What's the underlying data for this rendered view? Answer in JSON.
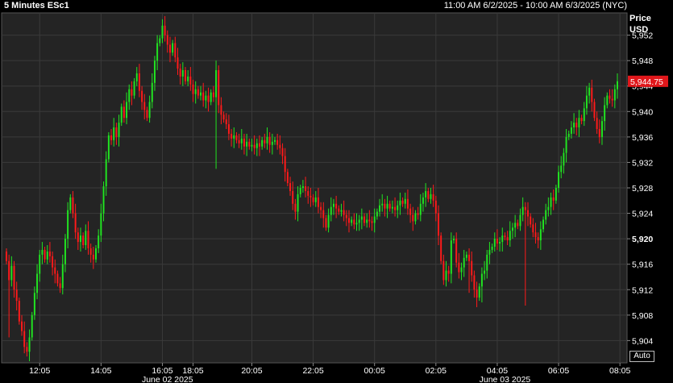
{
  "header": {
    "chart_label": "5 Minutes ESc1",
    "time_range": "11:00 AM 6/2/2025 - 10:00 AM 6/3/2025 (NYC)"
  },
  "axis": {
    "price_label": "Price",
    "currency_label": "USD",
    "auto_label": "Auto"
  },
  "colors": {
    "up": "#21e421",
    "down": "#ff1a1a",
    "plot_bg": "#242424",
    "grid": "#3a3a3a",
    "last_price_bg": "#e0171b"
  },
  "chart_data": {
    "type": "candlestick",
    "title": "5 Minutes ESc1",
    "ylabel": "Price USD",
    "ylim": [
      5900.5,
      5955.5
    ],
    "y_ticks": [
      5904,
      5908,
      5912,
      5916,
      5920,
      5924,
      5928,
      5932,
      5936,
      5940,
      5944,
      5948,
      5952
    ],
    "bold_tick": 5920,
    "last_price": "5,944.75",
    "last_value": 5944.75,
    "x_ticks": [
      "12:05",
      "14:05",
      "16:05",
      "18:05",
      "20:05",
      "22:05",
      "00:05",
      "02:05",
      "04:05",
      "06:05",
      "08:05"
    ],
    "date_labels": [
      "June 02 2025",
      "June 03 2025"
    ],
    "x_tick_index": [
      13,
      37,
      61,
      73,
      96,
      120,
      144,
      168,
      192,
      216,
      240
    ],
    "date_label_index": [
      63,
      195
    ],
    "grid": true,
    "closes": [
      5916.5,
      5913.5,
      5915.75,
      5912,
      5910.25,
      5907,
      5905.5,
      5903,
      5902.25,
      5904.5,
      5908,
      5911.5,
      5914.5,
      5917.5,
      5918.25,
      5916.75,
      5918,
      5917.25,
      5915.5,
      5914.5,
      5913,
      5912.25,
      5916,
      5920,
      5924.5,
      5926.5,
      5924,
      5921,
      5919.5,
      5920.5,
      5919,
      5921.25,
      5918.5,
      5917.5,
      5916.75,
      5918.5,
      5920.5,
      5924,
      5928.25,
      5932.5,
      5936.25,
      5935.5,
      5937.5,
      5936,
      5938.25,
      5940.75,
      5939,
      5941.5,
      5943.5,
      5942.5,
      5944.75,
      5946,
      5943.25,
      5941.5,
      5940.25,
      5939,
      5941.5,
      5944.5,
      5948,
      5950.75,
      5951.5,
      5953.5,
      5952,
      5950.5,
      5949.25,
      5950.75,
      5948.5,
      5946.75,
      5945.5,
      5946.5,
      5944.75,
      5945.5,
      5944.25,
      5942.75,
      5943.5,
      5942.5,
      5943,
      5941.75,
      5942.5,
      5941.5,
      5943,
      5942.25,
      5946.5,
      5941,
      5939.5,
      5938.75,
      5938,
      5936.5,
      5935.75,
      5936.25,
      5935.5,
      5935,
      5935.75,
      5934.5,
      5935.25,
      5934.5,
      5934.75,
      5934.25,
      5935,
      5934.5,
      5935.5,
      5935,
      5936,
      5934.75,
      5935.25,
      5935.5,
      5934.75,
      5934.25,
      5933,
      5930.5,
      5928.75,
      5927.5,
      5925.5,
      5924.25,
      5927,
      5928,
      5928.25,
      5927.5,
      5926.75,
      5926.5,
      5925.75,
      5926.5,
      5925,
      5924.5,
      5923.25,
      5921.75,
      5923.75,
      5925,
      5925.5,
      5924.75,
      5924.25,
      5924.5,
      5923.75,
      5923.25,
      5922.5,
      5923,
      5922.25,
      5922.5,
      5923,
      5923.5,
      5922.5,
      5923,
      5922.75,
      5922.5,
      5923.5,
      5924.25,
      5925.25,
      5925.5,
      5924.75,
      5925.5,
      5924.75,
      5925,
      5924.5,
      5925.25,
      5926,
      5925.5,
      5926.25,
      5924.75,
      5923.75,
      5922.75,
      5924,
      5923.75,
      5925.5,
      5926.5,
      5927.5,
      5926.25,
      5927,
      5926,
      5924,
      5920.5,
      5916.5,
      5913.5,
      5915,
      5914.5,
      5919.75,
      5920,
      5916.25,
      5914.75,
      5915.5,
      5917,
      5917.5,
      5916.5,
      5914.25,
      5912,
      5910.75,
      5912.5,
      5914.5,
      5915,
      5917.5,
      5918.25,
      5918.75,
      5920,
      5919.25,
      5919.5,
      5920.5,
      5920.25,
      5919.75,
      5921.25,
      5921.75,
      5922.5,
      5922,
      5923.75,
      5925,
      5924.5,
      5923.5,
      5922.25,
      5921,
      5920.25,
      5919.75,
      5921.5,
      5923,
      5924.5,
      5925,
      5926.5,
      5926,
      5928,
      5930.5,
      5931.5,
      5933.5,
      5936,
      5936.5,
      5937.5,
      5938.25,
      5937.5,
      5939,
      5938.5,
      5940.5,
      5942.5,
      5943.75,
      5941.5,
      5939,
      5937.25,
      5936,
      5938.5,
      5941,
      5942.5,
      5942,
      5941.75,
      5943.5,
      5944.75
    ]
  }
}
